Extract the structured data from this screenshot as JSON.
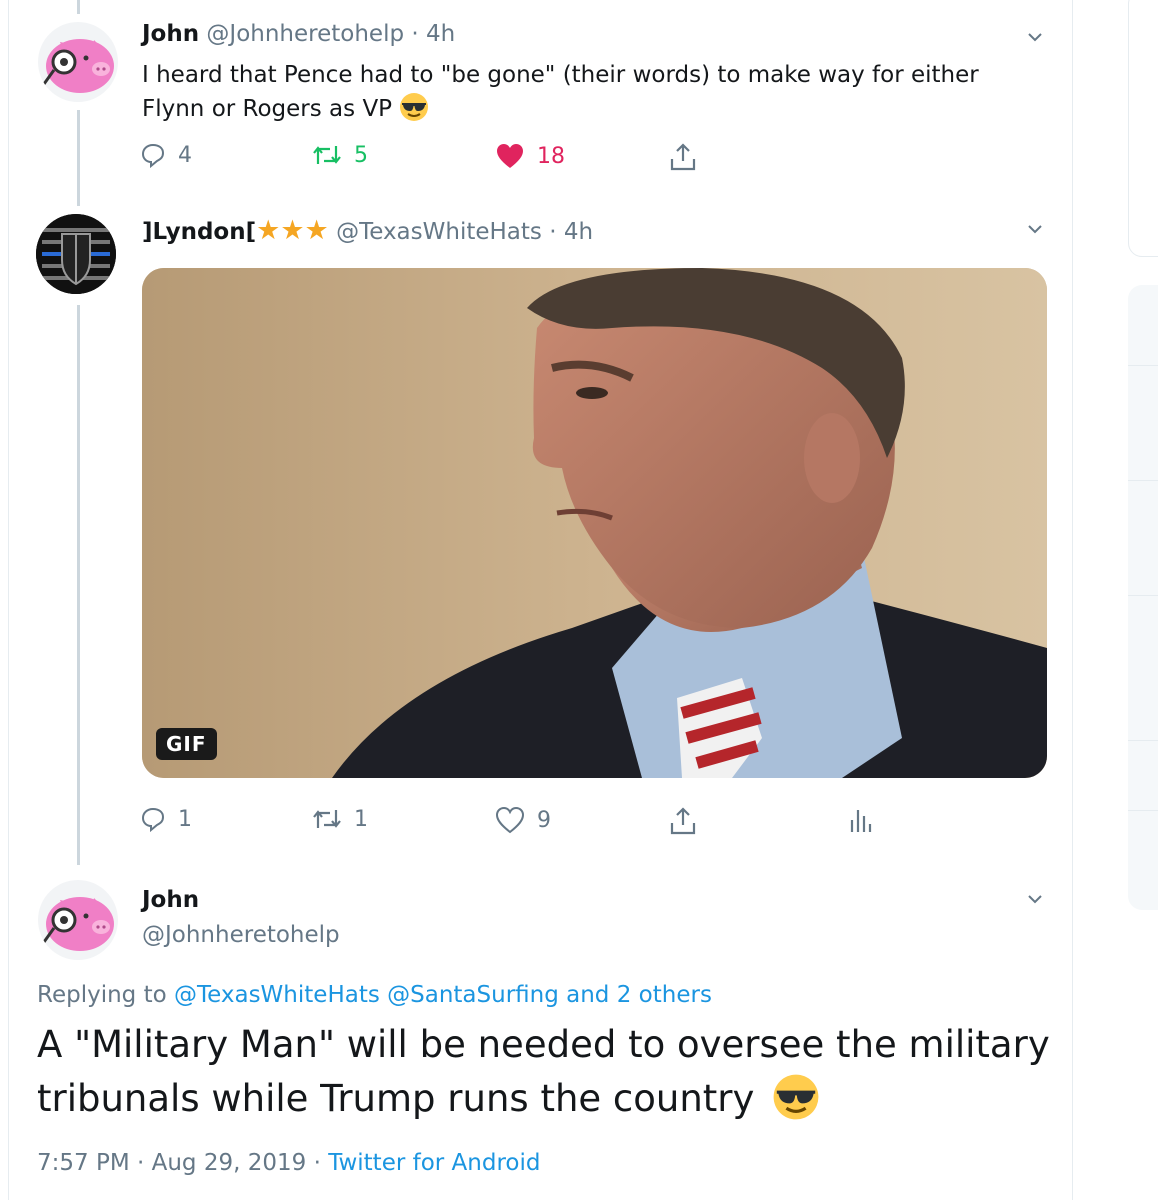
{
  "tweet1": {
    "name": "John",
    "handle": "@Johnheretohelp",
    "time": "· 4h",
    "text": "I heard that Pence had to \"be gone\" (their words) to make way for either Flynn or Rogers as VP",
    "emoji": "sunglasses",
    "replies": "4",
    "retweets": "5",
    "likes": "18",
    "liked": true
  },
  "tweet2": {
    "name": "]Lyndon[",
    "stars": "★★★",
    "handle": "@TexasWhiteHats",
    "time": "· 4h",
    "media_badge": "GIF",
    "replies": "1",
    "retweets": "1",
    "likes": "9"
  },
  "tweet3": {
    "name": "John",
    "handle": "@Johnheretohelp",
    "replying_prefix": "Replying to ",
    "replying_mention1": "@TexasWhiteHats",
    "replying_mention2": "@SantaSurfing",
    "replying_suffix": "and 2 others",
    "text": "A \"Military Man\" will be needed to oversee the military tribunals while Trump runs the country",
    "emoji": "sunglasses",
    "time": "7:57 PM",
    "date": "Aug 29, 2019",
    "source": "Twitter for Android"
  },
  "colors": {
    "accent": "#1b95e0",
    "like": "#e0245e",
    "retweet": "#17bf63",
    "muted": "#657786"
  }
}
